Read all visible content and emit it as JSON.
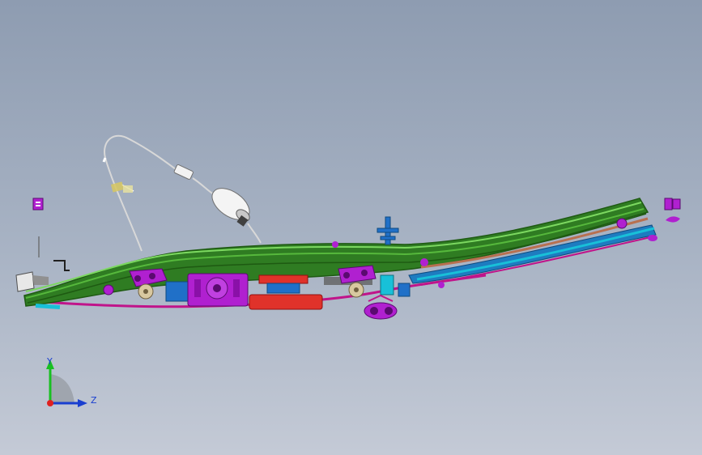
{
  "viewport": {
    "background_top": "#8e9cb1",
    "background_bottom": "#c4cad6"
  },
  "model": {
    "colors": {
      "rail_green": "#3f9a2a",
      "rail_dark": "#1e5a12",
      "bracket_purple": "#b020d0",
      "cable_magenta": "#c0148a",
      "accent_cyan": "#18c0d8",
      "part_blue": "#2070c8",
      "part_red": "#e0322a",
      "part_copper": "#b87050",
      "roller_tan": "#d8c8a0"
    }
  },
  "triad": {
    "y_label": "Y",
    "z_label": "Z",
    "y_color": "#18c020",
    "z_color": "#1a3fd0",
    "origin_color": "#e02020"
  }
}
